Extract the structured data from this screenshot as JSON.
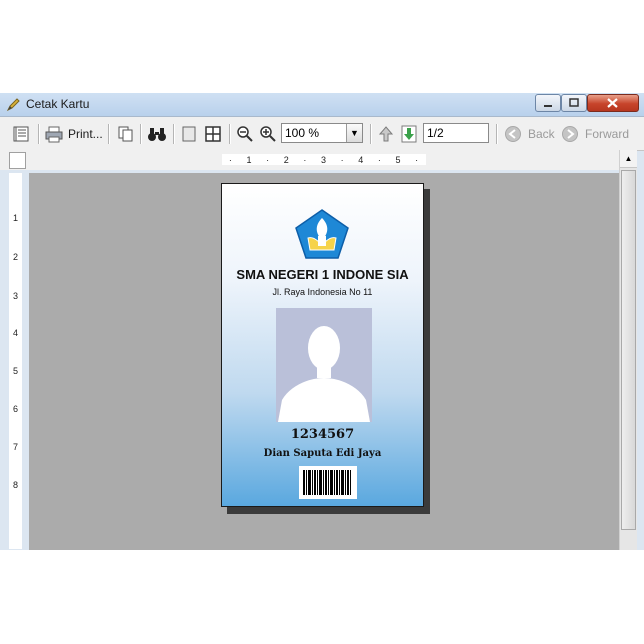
{
  "window": {
    "title": "Cetak Kartu"
  },
  "toolbar": {
    "print_label": "Print...",
    "zoom_value": "100 %",
    "page_value": "1/2",
    "back_label": "Back",
    "forward_label": "Forward"
  },
  "ruler": {
    "h_labels": [
      "1",
      "2",
      "3",
      "4",
      "5"
    ],
    "v_labels": [
      "1",
      "2",
      "3",
      "4",
      "5",
      "6",
      "7",
      "8"
    ]
  },
  "card": {
    "school_name": "SMA NEGERI 1 INDONE SIA",
    "school_address": "Jl. Raya Indonesia No 11",
    "student_id": "1234567",
    "student_name": "Dian Saputa Edi Jaya"
  },
  "colors": {
    "card_gradient_top": "#ffffff",
    "card_gradient_bottom": "#5aa8df",
    "viewport_bg": "#ababab",
    "logo_blue": "#1e88d6"
  }
}
